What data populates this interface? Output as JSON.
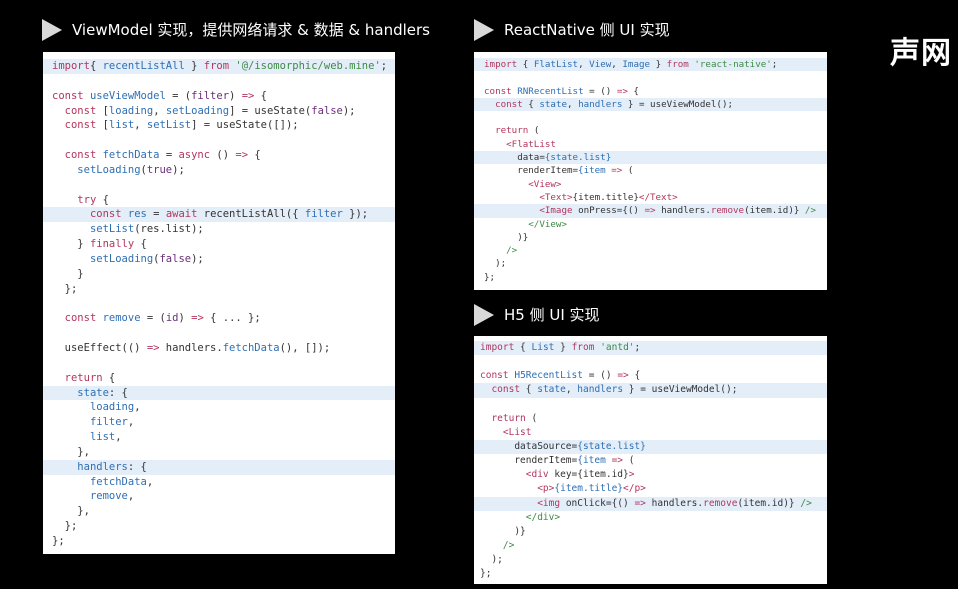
{
  "titles": {
    "viewmodel": "ViewModel 实现，提供网络请求 & 数据 & handlers",
    "reactnative": "ReactNative 侧 UI 实现",
    "h5": "H5 侧 UI 实现"
  },
  "brand": "声网",
  "code": {
    "viewmodel": [
      {
        "hl": true,
        "t": [
          [
            "k",
            "import"
          ],
          [
            "",
            "{ "
          ],
          [
            "f",
            "recentListAll"
          ],
          [
            "",
            " } "
          ],
          [
            "k",
            "from"
          ],
          [
            "",
            " "
          ],
          [
            "s",
            "'@/isomorphic/web.mine'"
          ],
          [
            "",
            ";"
          ]
        ]
      },
      {
        "t": []
      },
      {
        "t": [
          [
            "k",
            "const"
          ],
          [
            "",
            " "
          ],
          [
            "f",
            "useViewModel"
          ],
          [
            "",
            " = ("
          ],
          [
            "p",
            "filter"
          ],
          [
            "",
            ") "
          ],
          [
            "k",
            "=>"
          ],
          [
            "",
            " {"
          ]
        ]
      },
      {
        "t": [
          [
            "",
            "  "
          ],
          [
            "k",
            "const"
          ],
          [
            "",
            " ["
          ],
          [
            "f",
            "loading"
          ],
          [
            "",
            ", "
          ],
          [
            "f",
            "setLoading"
          ],
          [
            "",
            "] = useState("
          ],
          [
            "p",
            "false"
          ],
          [
            "",
            ");"
          ]
        ]
      },
      {
        "t": [
          [
            "",
            "  "
          ],
          [
            "k",
            "const"
          ],
          [
            "",
            " ["
          ],
          [
            "f",
            "list"
          ],
          [
            "",
            ", "
          ],
          [
            "f",
            "setList"
          ],
          [
            "",
            "] = useState([]);"
          ]
        ]
      },
      {
        "t": []
      },
      {
        "t": [
          [
            "",
            "  "
          ],
          [
            "k",
            "const"
          ],
          [
            "",
            " "
          ],
          [
            "f",
            "fetchData"
          ],
          [
            "",
            " = "
          ],
          [
            "k",
            "async"
          ],
          [
            "",
            " () "
          ],
          [
            "k",
            "=>"
          ],
          [
            "",
            " {"
          ]
        ]
      },
      {
        "t": [
          [
            "",
            "    "
          ],
          [
            "f",
            "setLoading"
          ],
          [
            "",
            "("
          ],
          [
            "p",
            "true"
          ],
          [
            "",
            ");"
          ]
        ]
      },
      {
        "t": []
      },
      {
        "t": [
          [
            "",
            "    "
          ],
          [
            "k",
            "try"
          ],
          [
            "",
            " {"
          ]
        ]
      },
      {
        "hl": true,
        "t": [
          [
            "",
            "      "
          ],
          [
            "k",
            "const"
          ],
          [
            "",
            " "
          ],
          [
            "f",
            "res"
          ],
          [
            "",
            " = "
          ],
          [
            "k",
            "await"
          ],
          [
            "",
            " recentListAll({ "
          ],
          [
            "f",
            "filter"
          ],
          [
            "",
            " });"
          ]
        ]
      },
      {
        "t": [
          [
            "",
            "      "
          ],
          [
            "f",
            "setList"
          ],
          [
            "",
            "(res.list);"
          ]
        ]
      },
      {
        "t": [
          [
            "",
            "    } "
          ],
          [
            "k",
            "finally"
          ],
          [
            "",
            " {"
          ]
        ]
      },
      {
        "t": [
          [
            "",
            "      "
          ],
          [
            "f",
            "setLoading"
          ],
          [
            "",
            "("
          ],
          [
            "p",
            "false"
          ],
          [
            "",
            ");"
          ]
        ]
      },
      {
        "t": [
          [
            "",
            "    }"
          ]
        ]
      },
      {
        "t": [
          [
            "",
            "  };"
          ]
        ]
      },
      {
        "t": []
      },
      {
        "t": [
          [
            "",
            "  "
          ],
          [
            "k",
            "const"
          ],
          [
            "",
            " "
          ],
          [
            "f",
            "remove"
          ],
          [
            "",
            " = ("
          ],
          [
            "p",
            "id"
          ],
          [
            "",
            ") "
          ],
          [
            "k",
            "=>"
          ],
          [
            "",
            " { ... };"
          ]
        ]
      },
      {
        "t": []
      },
      {
        "t": [
          [
            "",
            "  useEffect(() "
          ],
          [
            "k",
            "=>"
          ],
          [
            "",
            " handlers."
          ],
          [
            "f",
            "fetchData"
          ],
          [
            "",
            "(), []);"
          ]
        ]
      },
      {
        "t": []
      },
      {
        "t": [
          [
            "",
            "  "
          ],
          [
            "k",
            "return"
          ],
          [
            "",
            " {"
          ]
        ]
      },
      {
        "hl": true,
        "t": [
          [
            "",
            "    "
          ],
          [
            "f",
            "state"
          ],
          [
            "",
            ": {"
          ]
        ]
      },
      {
        "t": [
          [
            "",
            "      "
          ],
          [
            "f",
            "loading"
          ],
          [
            "",
            ","
          ]
        ]
      },
      {
        "t": [
          [
            "",
            "      "
          ],
          [
            "f",
            "filter"
          ],
          [
            "",
            ","
          ]
        ]
      },
      {
        "t": [
          [
            "",
            "      "
          ],
          [
            "f",
            "list"
          ],
          [
            "",
            ","
          ]
        ]
      },
      {
        "t": [
          [
            "",
            "    },"
          ]
        ]
      },
      {
        "hl": true,
        "t": [
          [
            "",
            "    "
          ],
          [
            "f",
            "handlers"
          ],
          [
            "",
            ": {"
          ]
        ]
      },
      {
        "t": [
          [
            "",
            "      "
          ],
          [
            "f",
            "fetchData"
          ],
          [
            "",
            ","
          ]
        ]
      },
      {
        "t": [
          [
            "",
            "      "
          ],
          [
            "f",
            "remove"
          ],
          [
            "",
            ","
          ]
        ]
      },
      {
        "t": [
          [
            "",
            "    },"
          ]
        ]
      },
      {
        "t": [
          [
            "",
            "  };"
          ]
        ]
      },
      {
        "t": [
          [
            "",
            "};"
          ]
        ]
      }
    ],
    "reactnative": [
      {
        "hl": true,
        "t": [
          [
            "k",
            "import"
          ],
          [
            "",
            " { "
          ],
          [
            "f",
            "FlatList"
          ],
          [
            "",
            ", "
          ],
          [
            "f",
            "View"
          ],
          [
            "",
            ", "
          ],
          [
            "f",
            "Image"
          ],
          [
            "",
            " } "
          ],
          [
            "k",
            "from"
          ],
          [
            "",
            " "
          ],
          [
            "s",
            "'react-native'"
          ],
          [
            "",
            ";"
          ]
        ]
      },
      {
        "t": []
      },
      {
        "t": [
          [
            "k",
            "const"
          ],
          [
            "",
            " "
          ],
          [
            "f",
            "RNRecentList"
          ],
          [
            "",
            " = () "
          ],
          [
            "k",
            "=>"
          ],
          [
            "",
            " {"
          ]
        ]
      },
      {
        "hl": true,
        "t": [
          [
            "",
            "  "
          ],
          [
            "k",
            "const"
          ],
          [
            "",
            " { "
          ],
          [
            "f",
            "state"
          ],
          [
            "",
            ", "
          ],
          [
            "f",
            "handlers"
          ],
          [
            "",
            " } = useViewModel();"
          ]
        ]
      },
      {
        "t": []
      },
      {
        "t": [
          [
            "",
            "  "
          ],
          [
            "k",
            "return"
          ],
          [
            "",
            " ("
          ]
        ]
      },
      {
        "t": [
          [
            "",
            "    "
          ],
          [
            "t",
            "<FlatList"
          ]
        ]
      },
      {
        "hl": true,
        "t": [
          [
            "",
            "      data="
          ],
          [
            "f",
            "{state.list}"
          ]
        ]
      },
      {
        "t": [
          [
            "",
            "      renderItem="
          ],
          [
            "f",
            "{item"
          ],
          [
            "",
            " "
          ],
          [
            "k",
            "=>"
          ],
          [
            "",
            " ("
          ]
        ]
      },
      {
        "t": [
          [
            "",
            "        "
          ],
          [
            "t",
            "<View>"
          ]
        ]
      },
      {
        "t": [
          [
            "",
            "          "
          ],
          [
            "t",
            "<Text>"
          ],
          [
            "",
            "{item.title}"
          ],
          [
            "t",
            "</Text>"
          ]
        ]
      },
      {
        "hl": true,
        "t": [
          [
            "",
            "          "
          ],
          [
            "t",
            "<Image"
          ],
          [
            "",
            " onPress={() "
          ],
          [
            "k",
            "=>"
          ],
          [
            "",
            " handlers."
          ],
          [
            "k",
            "remove"
          ],
          [
            "",
            "(item.id)} "
          ],
          [
            "g",
            "/>"
          ]
        ]
      },
      {
        "t": [
          [
            "",
            "        "
          ],
          [
            "g",
            "</View>"
          ]
        ]
      },
      {
        "t": [
          [
            "",
            "      )}"
          ]
        ]
      },
      {
        "t": [
          [
            "",
            "    "
          ],
          [
            "g",
            "/>"
          ]
        ]
      },
      {
        "t": [
          [
            "",
            "  );"
          ]
        ]
      },
      {
        "t": [
          [
            "",
            "};"
          ]
        ]
      }
    ],
    "h5": [
      {
        "hl": true,
        "t": [
          [
            "k",
            "import"
          ],
          [
            "",
            " { "
          ],
          [
            "f",
            "List"
          ],
          [
            "",
            " } "
          ],
          [
            "k",
            "from"
          ],
          [
            "",
            " "
          ],
          [
            "s",
            "'antd'"
          ],
          [
            "",
            ";"
          ]
        ]
      },
      {
        "t": []
      },
      {
        "t": [
          [
            "k",
            "const"
          ],
          [
            "",
            " "
          ],
          [
            "f",
            "H5RecentList"
          ],
          [
            "",
            " = () "
          ],
          [
            "k",
            "=>"
          ],
          [
            "",
            " {"
          ]
        ]
      },
      {
        "hl": true,
        "t": [
          [
            "",
            "  "
          ],
          [
            "k",
            "const"
          ],
          [
            "",
            " { "
          ],
          [
            "f",
            "state"
          ],
          [
            "",
            ", "
          ],
          [
            "f",
            "handlers"
          ],
          [
            "",
            " } = useViewModel();"
          ]
        ]
      },
      {
        "t": []
      },
      {
        "t": [
          [
            "",
            "  "
          ],
          [
            "k",
            "return"
          ],
          [
            "",
            " ("
          ]
        ]
      },
      {
        "t": [
          [
            "",
            "    "
          ],
          [
            "t",
            "<List"
          ]
        ]
      },
      {
        "hl": true,
        "t": [
          [
            "",
            "      dataSource="
          ],
          [
            "f",
            "{state.list}"
          ]
        ]
      },
      {
        "t": [
          [
            "",
            "      renderItem="
          ],
          [
            "f",
            "{item"
          ],
          [
            "",
            " "
          ],
          [
            "k",
            "=>"
          ],
          [
            "",
            " ("
          ]
        ]
      },
      {
        "t": [
          [
            "",
            "        "
          ],
          [
            "t",
            "<div"
          ],
          [
            "",
            " key={item.id}"
          ],
          [
            "t",
            ">"
          ]
        ]
      },
      {
        "t": [
          [
            "",
            "          "
          ],
          [
            "t",
            "<p>"
          ],
          [
            "f",
            "{item.title}"
          ],
          [
            "t",
            "</p>"
          ]
        ]
      },
      {
        "hl": true,
        "t": [
          [
            "",
            "          "
          ],
          [
            "t",
            "<img"
          ],
          [
            "",
            " onClick={() "
          ],
          [
            "k",
            "=>"
          ],
          [
            "",
            " handlers."
          ],
          [
            "k",
            "remove"
          ],
          [
            "",
            "(item.id)} "
          ],
          [
            "g",
            "/>"
          ]
        ]
      },
      {
        "t": [
          [
            "",
            "        "
          ],
          [
            "g",
            "</div>"
          ]
        ]
      },
      {
        "t": [
          [
            "",
            "      )}"
          ]
        ]
      },
      {
        "t": [
          [
            "",
            "    "
          ],
          [
            "g",
            "/>"
          ]
        ]
      },
      {
        "t": [
          [
            "",
            "  );"
          ]
        ]
      },
      {
        "t": [
          [
            "",
            "};"
          ]
        ]
      }
    ]
  }
}
